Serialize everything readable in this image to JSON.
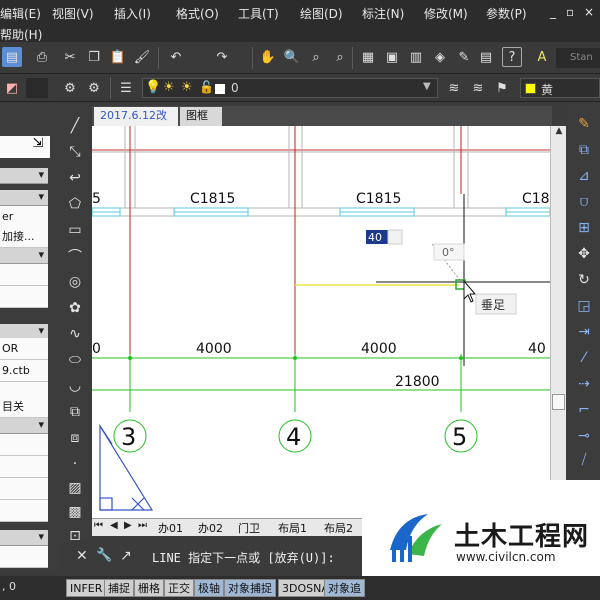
{
  "menu": {
    "items": [
      "编辑(E)",
      "视图(V)",
      "插入(I)",
      "格式(O)",
      "工具(T)",
      "绘图(D)",
      "标注(N)",
      "修改(M)",
      "参数(P)"
    ],
    "help": "帮助(H)",
    "window_controls": [
      "_",
      "▫",
      "×"
    ]
  },
  "toolbar": {
    "text_style_value": "Stan",
    "layer_value": "0",
    "color_value": "黄",
    "color_swatch": "#ffff00"
  },
  "left_panel": {
    "rows": [
      "er",
      "加接...",
      "OR",
      "9.ctb",
      "目关"
    ]
  },
  "file_tabs": [
    "2017.6.12改",
    "图框"
  ],
  "drawing": {
    "columns": [
      "C1815",
      "C1815",
      "C18"
    ],
    "partial_label": "5",
    "dims": [
      "0",
      "4000",
      "4000",
      "40"
    ],
    "total_dim": "21800",
    "axis_labels": [
      "3",
      "4",
      "5"
    ],
    "input_value": "40",
    "angle_tip": "0°",
    "snap_tip": "垂足"
  },
  "layout_tabs": [
    "办01",
    "办02",
    "门卫",
    "布局1",
    "布局2"
  ],
  "command": {
    "prompt": "LINE 指定下一点或 [放弃(U)]:",
    "option_key": "U"
  },
  "status": {
    "coords": ", 0",
    "buttons": [
      "INFER",
      "捕捉",
      "栅格",
      "正交",
      "极轴",
      "对象捕捉",
      "3DOSNAP",
      "对象追"
    ]
  },
  "watermark": {
    "title": "土木工程网",
    "url": "www.civilcn.com"
  },
  "colors": {
    "grid_red": "#c81e1e",
    "dim_green": "#22c122",
    "window_cyan": "#5ac8dc",
    "track_yellow": "#e6e64a",
    "logo_blue": "#1a66c9",
    "logo_green": "#3bb54a"
  }
}
